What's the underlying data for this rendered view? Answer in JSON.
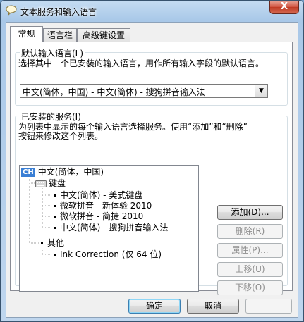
{
  "window": {
    "title": "文本服务和输入语言",
    "close_label": "X"
  },
  "tabs": [
    {
      "label": "常规",
      "active": true
    },
    {
      "label": "语言栏",
      "active": false
    },
    {
      "label": "高级键设置",
      "active": false
    }
  ],
  "default_language": {
    "group_label": "默认输入语言(L)",
    "description": "选择其中一个已安装的输入语言，用作所有输入字段的默认语言。",
    "selected_value": "中文(简体，中国) - 中文(简体) - 搜狗拼音输入法"
  },
  "installed_services": {
    "group_label": "已安装的服务(I)",
    "description_line1": "为列表中显示的每个输入语言选择服务。使用“添加”和“删除”",
    "description_line2": "按钮来修改这个列表。",
    "tree": {
      "language_badge": "CH",
      "language": "中文(简体，中国)",
      "keyboard_label": "键盘",
      "keyboard_items": [
        "中文(简体) - 美式键盘",
        "微软拼音 - 新体验 2010",
        "微软拼音 - 简捷 2010",
        "中文(简体) - 搜狗拼音输入法"
      ],
      "other_label": "其他",
      "other_items": [
        "Ink Correction (仅 64 位)"
      ]
    },
    "buttons": {
      "add": "添加(D)...",
      "remove": "删除(R)",
      "properties": "属性(P)...",
      "move_up": "上移(U)",
      "move_down": "下移(O)"
    }
  },
  "footer": {
    "ok": "确定",
    "cancel": "取消",
    "apply": ""
  },
  "colors": {
    "accent": "#3a7fd5",
    "titlebar": "#a9c8e8",
    "close": "#c03a24"
  }
}
